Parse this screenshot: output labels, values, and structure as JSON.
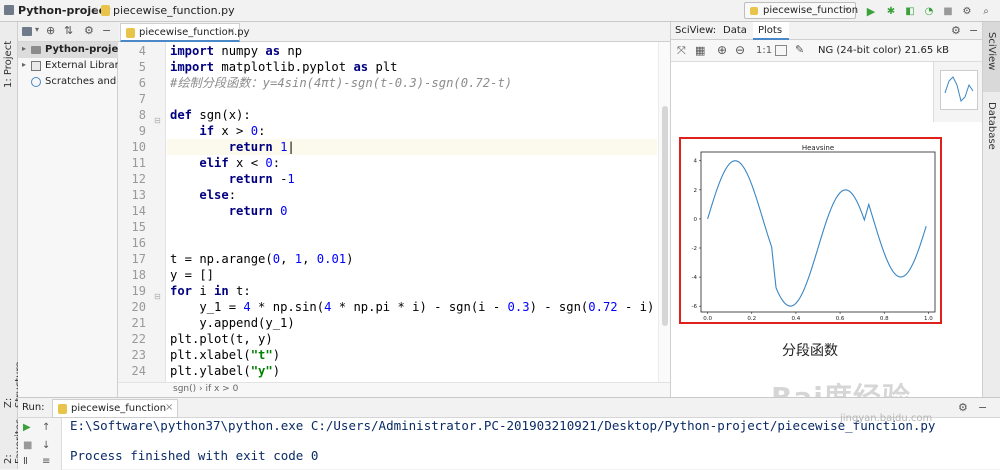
{
  "nav": {
    "project": "Python-project",
    "file": "piecewise_function.py",
    "run_config": "piecewise_function"
  },
  "left_strip": {
    "project_label": "1: Project",
    "structure_label": "Z: Structure",
    "favorites_label": "2: Favorites"
  },
  "right_strip": {
    "sciview_label": "SciView",
    "database_label": "Database"
  },
  "project_tree": [
    {
      "label": "Python-project"
    },
    {
      "label": "External Libraries"
    },
    {
      "label": "Scratches and Co"
    }
  ],
  "editor": {
    "tab_label": "piecewise_function.py",
    "line_numbers": [
      "4",
      "5",
      "6",
      "7",
      "8",
      "9",
      "10",
      "11",
      "12",
      "13",
      "14",
      "15",
      "16",
      "17",
      "18",
      "19",
      "20",
      "21",
      "22",
      "23",
      "24"
    ],
    "breadcrumb": "sgn()  ›  if x > 0"
  },
  "sciview": {
    "tabs": [
      "SciView:",
      "Data",
      "Plots"
    ],
    "scale_label": "1:1",
    "image_info": "NG (24-bit color) 21.65 kB",
    "chart_title": "Heavsine",
    "xlabel": "t",
    "annotation": "分段函数",
    "annotation_color": "#e0201b"
  },
  "chart_data": {
    "type": "line",
    "title": "Heavsine",
    "xlabel": "t",
    "ylabel": "",
    "xlim": [
      -0.03,
      1.03
    ],
    "ylim": [
      -6.4,
      4.6
    ],
    "xticks": [
      "0.0",
      "0.2",
      "0.4",
      "0.6",
      "0.8",
      "1.0"
    ],
    "yticks": [
      "4",
      "2",
      "0",
      "-2",
      "-4",
      "-6"
    ],
    "formula": "y=4sin(4πt)-sgn(t-0.3)-sgn(0.72-t)",
    "color": "#3a86c4"
  },
  "run": {
    "tab_label": "Run:",
    "config_label": "piecewise_function",
    "command": "E:\\Software\\python37\\python.exe C:/Users/Administrator.PC-201903210921/Desktop/Python-project/piecewise_function.py",
    "exit_message": "Process finished with exit code 0"
  },
  "watermark": {
    "brand": "Bai度经验",
    "url": "jingyan.baidu.com"
  }
}
